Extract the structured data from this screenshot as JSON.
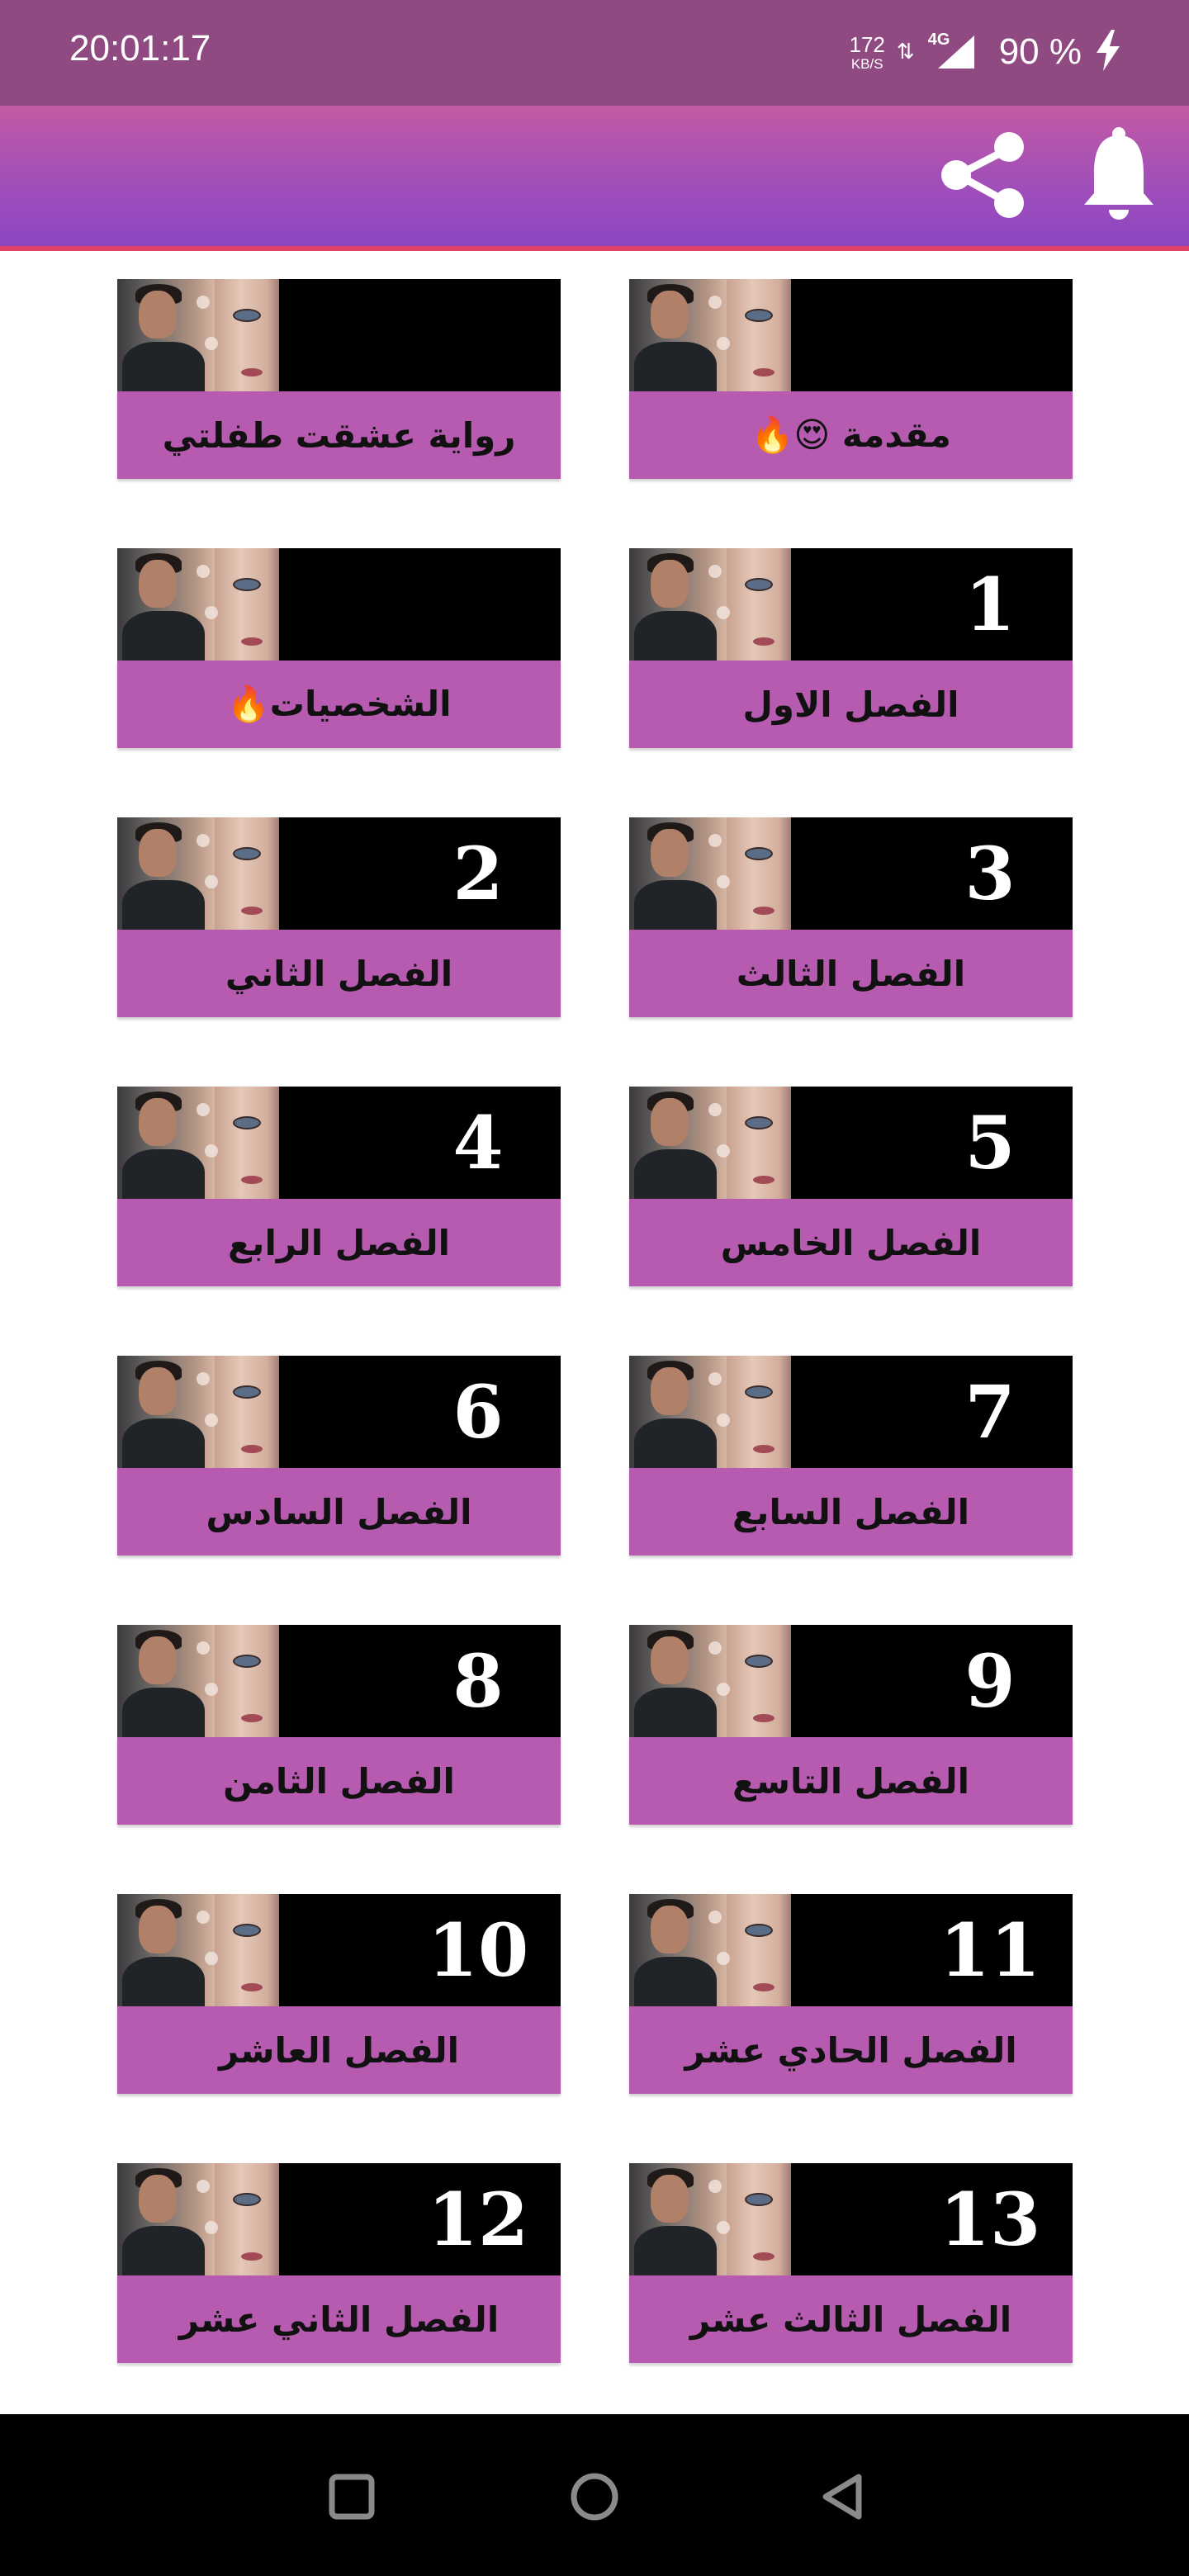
{
  "status_bar": {
    "time": "20:01:17",
    "speed_value": "172",
    "speed_unit": "KB/S",
    "network": "4G",
    "battery": "90 %"
  },
  "app_bar": {
    "share_icon": "share-icon",
    "bell_icon": "bell-icon"
  },
  "colors": {
    "status_bar": "#904a82",
    "app_bar_top": "#c35aa4",
    "app_bar_bottom": "#8c46c2",
    "label_bg": "#b65bb0",
    "accent_line": "#e0426a"
  },
  "chapters": [
    {
      "label": "مقدمة 😍🔥",
      "numeral": ""
    },
    {
      "label": "رواية عشقت طفلتي",
      "numeral": ""
    },
    {
      "label": "الفصل الاول",
      "numeral": "1"
    },
    {
      "label": "الشخصيات🔥",
      "numeral": ""
    },
    {
      "label": "الفصل الثالث",
      "numeral": "3"
    },
    {
      "label": "الفصل الثاني",
      "numeral": "2"
    },
    {
      "label": "الفصل الخامس",
      "numeral": "5"
    },
    {
      "label": "الفصل الرابع",
      "numeral": "4"
    },
    {
      "label": "الفصل السابع",
      "numeral": "7"
    },
    {
      "label": "الفصل السادس",
      "numeral": "6"
    },
    {
      "label": "الفصل التاسع",
      "numeral": "9"
    },
    {
      "label": "الفصل الثامن",
      "numeral": "8"
    },
    {
      "label": "الفصل الحادي عشر",
      "numeral": "11"
    },
    {
      "label": "الفصل العاشر",
      "numeral": "10"
    },
    {
      "label": "الفصل الثالث عشر",
      "numeral": "13"
    },
    {
      "label": "الفصل الثاني عشر",
      "numeral": "12"
    }
  ],
  "nav_bar": {
    "recents_icon": "square-icon",
    "home_icon": "circle-icon",
    "back_icon": "triangle-back-icon"
  }
}
